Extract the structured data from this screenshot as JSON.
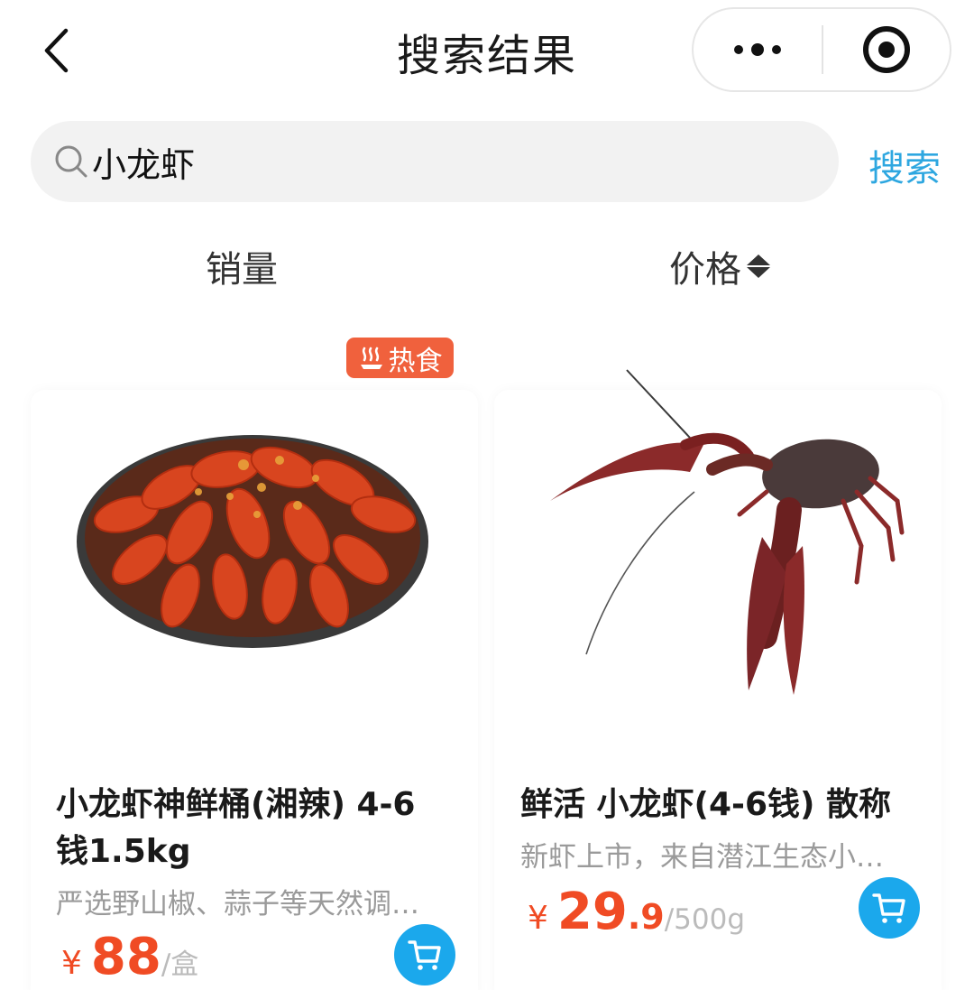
{
  "header": {
    "title": "搜索结果",
    "back_icon": "chevron-left-icon",
    "more_icon": "more-dots-icon",
    "close_icon": "target-close-icon"
  },
  "search": {
    "value": "小龙虾",
    "placeholder": "",
    "submit_label": "搜索"
  },
  "sort": {
    "sales_label": "销量",
    "price_label": "价格"
  },
  "colors": {
    "accent": "#1ba8ec",
    "search_link": "#2ea7e0",
    "price": "#f04b24",
    "badge": "#f0613d"
  },
  "products": [
    {
      "badge": "热食",
      "badge_icon": "hot-steam-icon",
      "title": "小龙虾神鲜桶(湘辣) 4-6钱1.5kg",
      "desc": "严选野山椒、蒜子等天然调…",
      "currency": "¥",
      "price_int": "88",
      "price_dec": "",
      "unit": "/盒",
      "image_alt": "spicy-crayfish-plate",
      "cart_icon": "cart-icon"
    },
    {
      "badge": "",
      "title": "鲜活 小龙虾(4-6钱) 散称",
      "desc": "新虾上市，来自潜江生态小…",
      "currency": "¥",
      "price_int": "29",
      "price_dec": ".9",
      "unit": "/500g",
      "image_alt": "live-crayfish",
      "cart_icon": "cart-icon"
    }
  ]
}
